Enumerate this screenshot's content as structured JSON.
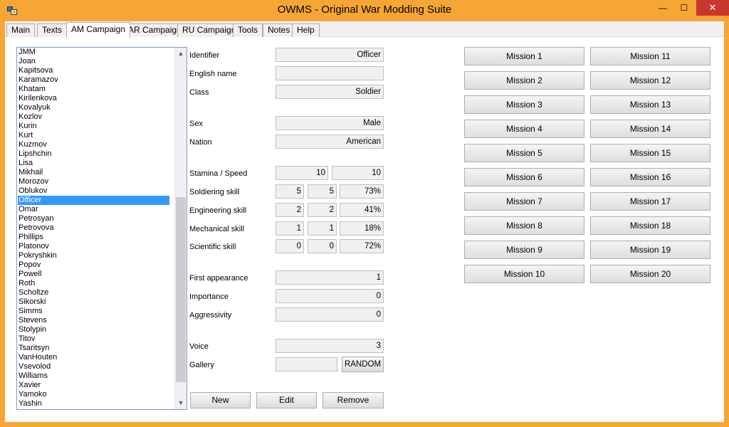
{
  "window": {
    "title": "OWMS - Original War Modding Suite",
    "minimize_glyph": "—",
    "maximize_glyph": "☐",
    "close_glyph": "✕"
  },
  "tabs": [
    {
      "label": "Main"
    },
    {
      "label": "Texts"
    },
    {
      "label": "AM Campaign"
    },
    {
      "label": "AR Campaign"
    },
    {
      "label": "RU Campaign"
    },
    {
      "label": "Tools"
    },
    {
      "label": "Notes"
    },
    {
      "label": "Help"
    }
  ],
  "active_tab": "AM Campaign",
  "character_list": {
    "items": [
      "JMM",
      "Joan",
      "Kapitsova",
      "Karamazov",
      "Khatam",
      "Kirilenkova",
      "Kovalyuk",
      "Kozlov",
      "Kurin",
      "Kurt",
      "Kuzmov",
      "Lipshchin",
      "Lisa",
      "Mikhail",
      "Morozov",
      "Oblukov",
      "Officer",
      "Omar",
      "Petrosyan",
      "Petrovova",
      "Phillips",
      "Platonov",
      "Pokryshkin",
      "Popov",
      "Powell",
      "Roth",
      "Scholtze",
      "Sikorski",
      "Simms",
      "Stevens",
      "Stolypin",
      "Titov",
      "Tsaritsyn",
      "VanHouten",
      "Vsevolod",
      "Williams",
      "Xavier",
      "Yamoko",
      "Yashin"
    ],
    "selected": "Officer",
    "scroll_up_glyph": "▲",
    "scroll_down_glyph": "▼",
    "scroll_position": 0.9
  },
  "form": {
    "identifier": {
      "label": "Identifier",
      "value": "Officer"
    },
    "english_name": {
      "label": "English name",
      "value": ""
    },
    "class": {
      "label": "Class",
      "value": "Soldier"
    },
    "sex": {
      "label": "Sex",
      "value": "Male"
    },
    "nation": {
      "label": "Nation",
      "value": "American"
    },
    "stamina_speed": {
      "label": "Stamina / Speed",
      "stamina": "10",
      "speed": "10"
    },
    "soldiering": {
      "label": "Soldiering skill",
      "a": "5",
      "b": "5",
      "pct": "73%"
    },
    "engineering": {
      "label": "Engineering skill",
      "a": "2",
      "b": "2",
      "pct": "41%"
    },
    "mechanical": {
      "label": "Mechanical skill",
      "a": "1",
      "b": "1",
      "pct": "18%"
    },
    "scientific": {
      "label": "Scientific skill",
      "a": "0",
      "b": "0",
      "pct": "72%"
    },
    "first_appearance": {
      "label": "First appearance",
      "value": "1"
    },
    "importance": {
      "label": "Importance",
      "value": "0"
    },
    "aggressivity": {
      "label": "Aggressivity",
      "value": "0"
    },
    "voice": {
      "label": "Voice",
      "value": "3"
    },
    "gallery": {
      "label": "Gallery",
      "value": "",
      "random_label": "RANDOM"
    }
  },
  "actions": {
    "new_label": "New",
    "edit_label": "Edit",
    "remove_label": "Remove"
  },
  "missions": [
    "Mission 1",
    "Mission 2",
    "Mission 3",
    "Mission 4",
    "Mission 5",
    "Mission 6",
    "Mission 7",
    "Mission 8",
    "Mission 9",
    "Mission 10",
    "Mission 11",
    "Mission 12",
    "Mission 13",
    "Mission 14",
    "Mission 15",
    "Mission 16",
    "Mission 17",
    "Mission 18",
    "Mission 19",
    "Mission 20"
  ]
}
